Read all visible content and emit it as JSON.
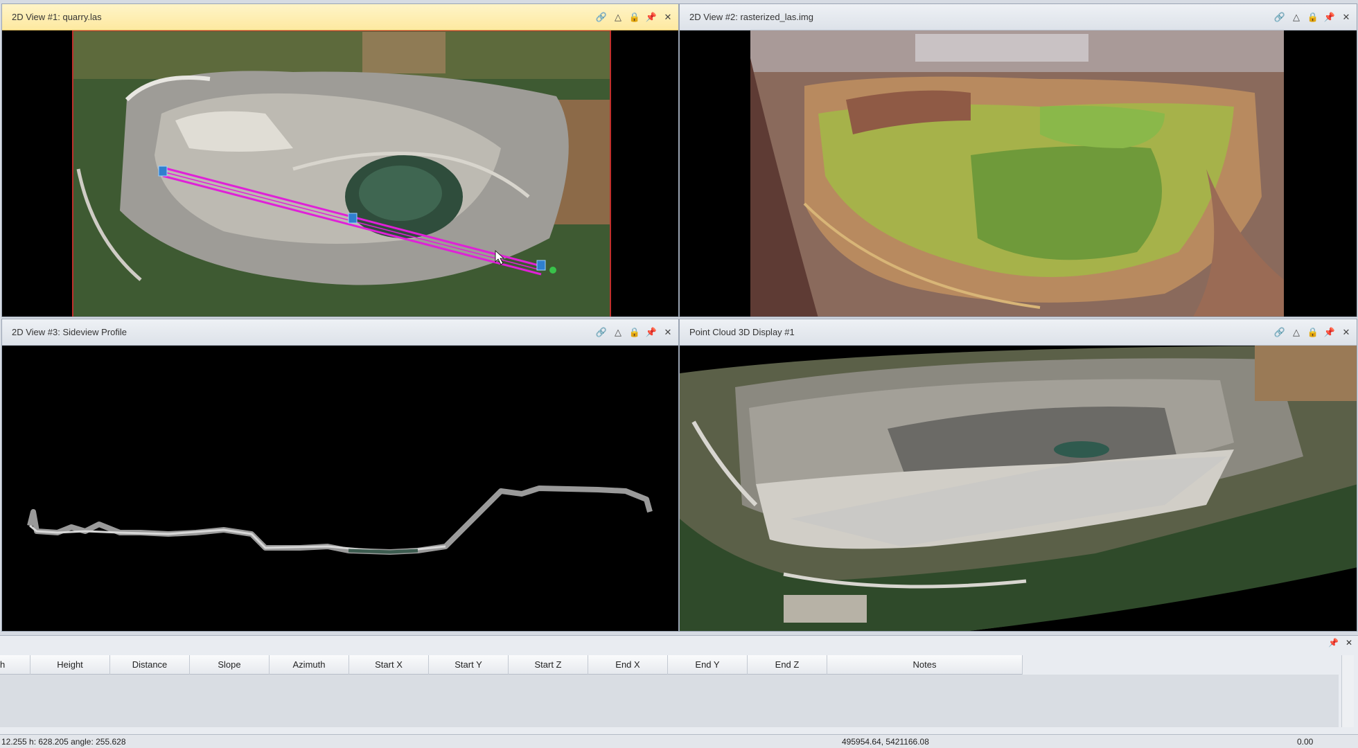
{
  "views": [
    {
      "title": "2D View #1: quarry.las",
      "active": true
    },
    {
      "title": "2D View #2: rasterized_las.img",
      "active": false
    },
    {
      "title": "2D View #3: Sideview Profile",
      "active": false
    },
    {
      "title": "Point Cloud 3D Display #1",
      "active": false
    }
  ],
  "icons": [
    "link-icon",
    "warning-icon",
    "lock-icon",
    "pin-icon",
    "close-icon"
  ],
  "measurement_table": {
    "columns": [
      "h",
      "Height",
      "Distance",
      "Slope",
      "Azimuth",
      "Start X",
      "Start Y",
      "Start Z",
      "End X",
      "End Y",
      "End Z",
      "Notes"
    ],
    "rows": []
  },
  "status": {
    "left": "12.255   h:  628.205   angle:  255.628",
    "coords": "495954.64, 5421166.08",
    "right": "0.00"
  }
}
